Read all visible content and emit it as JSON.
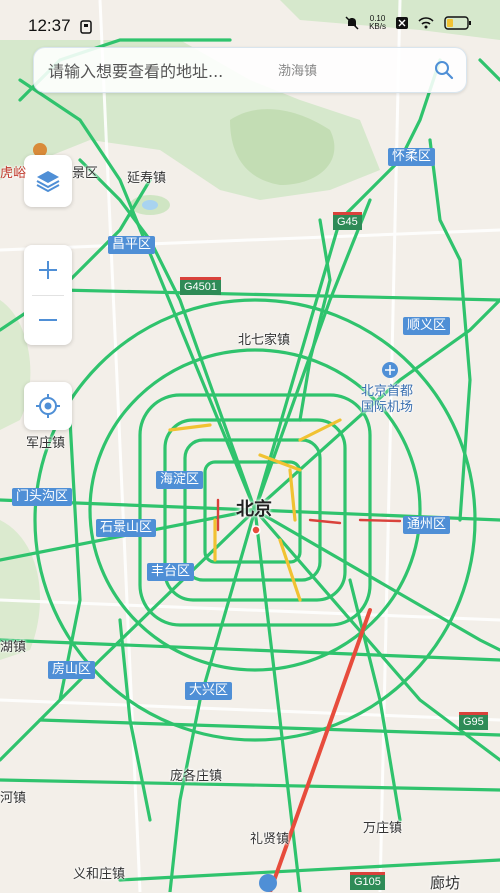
{
  "status_bar": {
    "time": "12:37",
    "net_speed_value": "0.10",
    "net_speed_unit": "KB/s",
    "icons": [
      "sim-icon",
      "mute-icon",
      "notification-icon",
      "wifi-icon",
      "battery-icon"
    ]
  },
  "search": {
    "placeholder": "请输入想要查看的地址...",
    "hint_place": "渤海镇"
  },
  "controls": {
    "layers": "layers-icon",
    "zoom_in": "+",
    "zoom_out": "−",
    "locate": "locate-icon"
  },
  "map": {
    "city_label": "北京",
    "colors": {
      "road_green": "#2fc36d",
      "road_yellow": "#f1c232",
      "road_red": "#d9423b",
      "district_blue": "#4f8fd6",
      "route_red": "#e74c3c",
      "park_green": "#cfe5c3"
    },
    "districts": {
      "huairou": "怀柔区",
      "changping": "昌平区",
      "shunyi": "顺义区",
      "haidian": "海淀区",
      "mentougou": "门头沟区",
      "shijingshan": "石景山区",
      "tongzhou": "通州区",
      "fengtai": "丰台区",
      "fangshan": "房山区",
      "daxing": "大兴区"
    },
    "places": {
      "yanshou": "延寿镇",
      "beiqijia": "北七家镇",
      "airport": "北京首都\n国际机场",
      "jingqu": "景区",
      "hu": "虎峪",
      "zhuangzhen": "军庄镇",
      "huzhen": "湖镇",
      "panggezhuang": "庞各庄镇",
      "lixian": "礼贤镇",
      "wanzhuang": "万庄镇",
      "yiheizhuang": "义和庄镇",
      "langfang": "廊坊",
      "he": "河镇"
    },
    "highways": {
      "g45": "G45",
      "g4501": "G4501",
      "g95": "G95",
      "g105": "G105"
    }
  }
}
